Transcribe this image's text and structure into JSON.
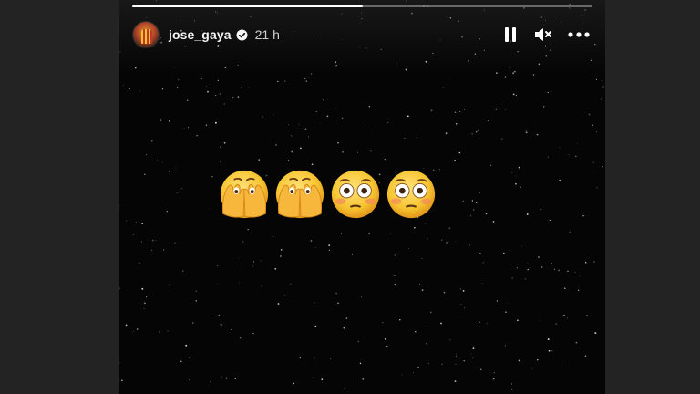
{
  "story": {
    "progress_fraction": 0.5,
    "user": {
      "username": "jose_gaya",
      "verified": true,
      "time_ago": "21 h"
    },
    "controls": {
      "pause_icon": "pause-icon",
      "mute_icon": "speaker-muted-icon",
      "more_icon": "more-options-icon"
    },
    "content": {
      "emojis": [
        "🫣",
        "🫣",
        "😳",
        "😳"
      ],
      "emoji_names": [
        "face-with-peeking-eye",
        "face-with-peeking-eye",
        "flushed-face",
        "flushed-face"
      ],
      "background": "starry-night"
    }
  },
  "colors": {
    "story_background": "#050505",
    "page_background": "#232323",
    "text_primary": "#f5f5f5",
    "emoji_yellow": "#f7c531"
  }
}
